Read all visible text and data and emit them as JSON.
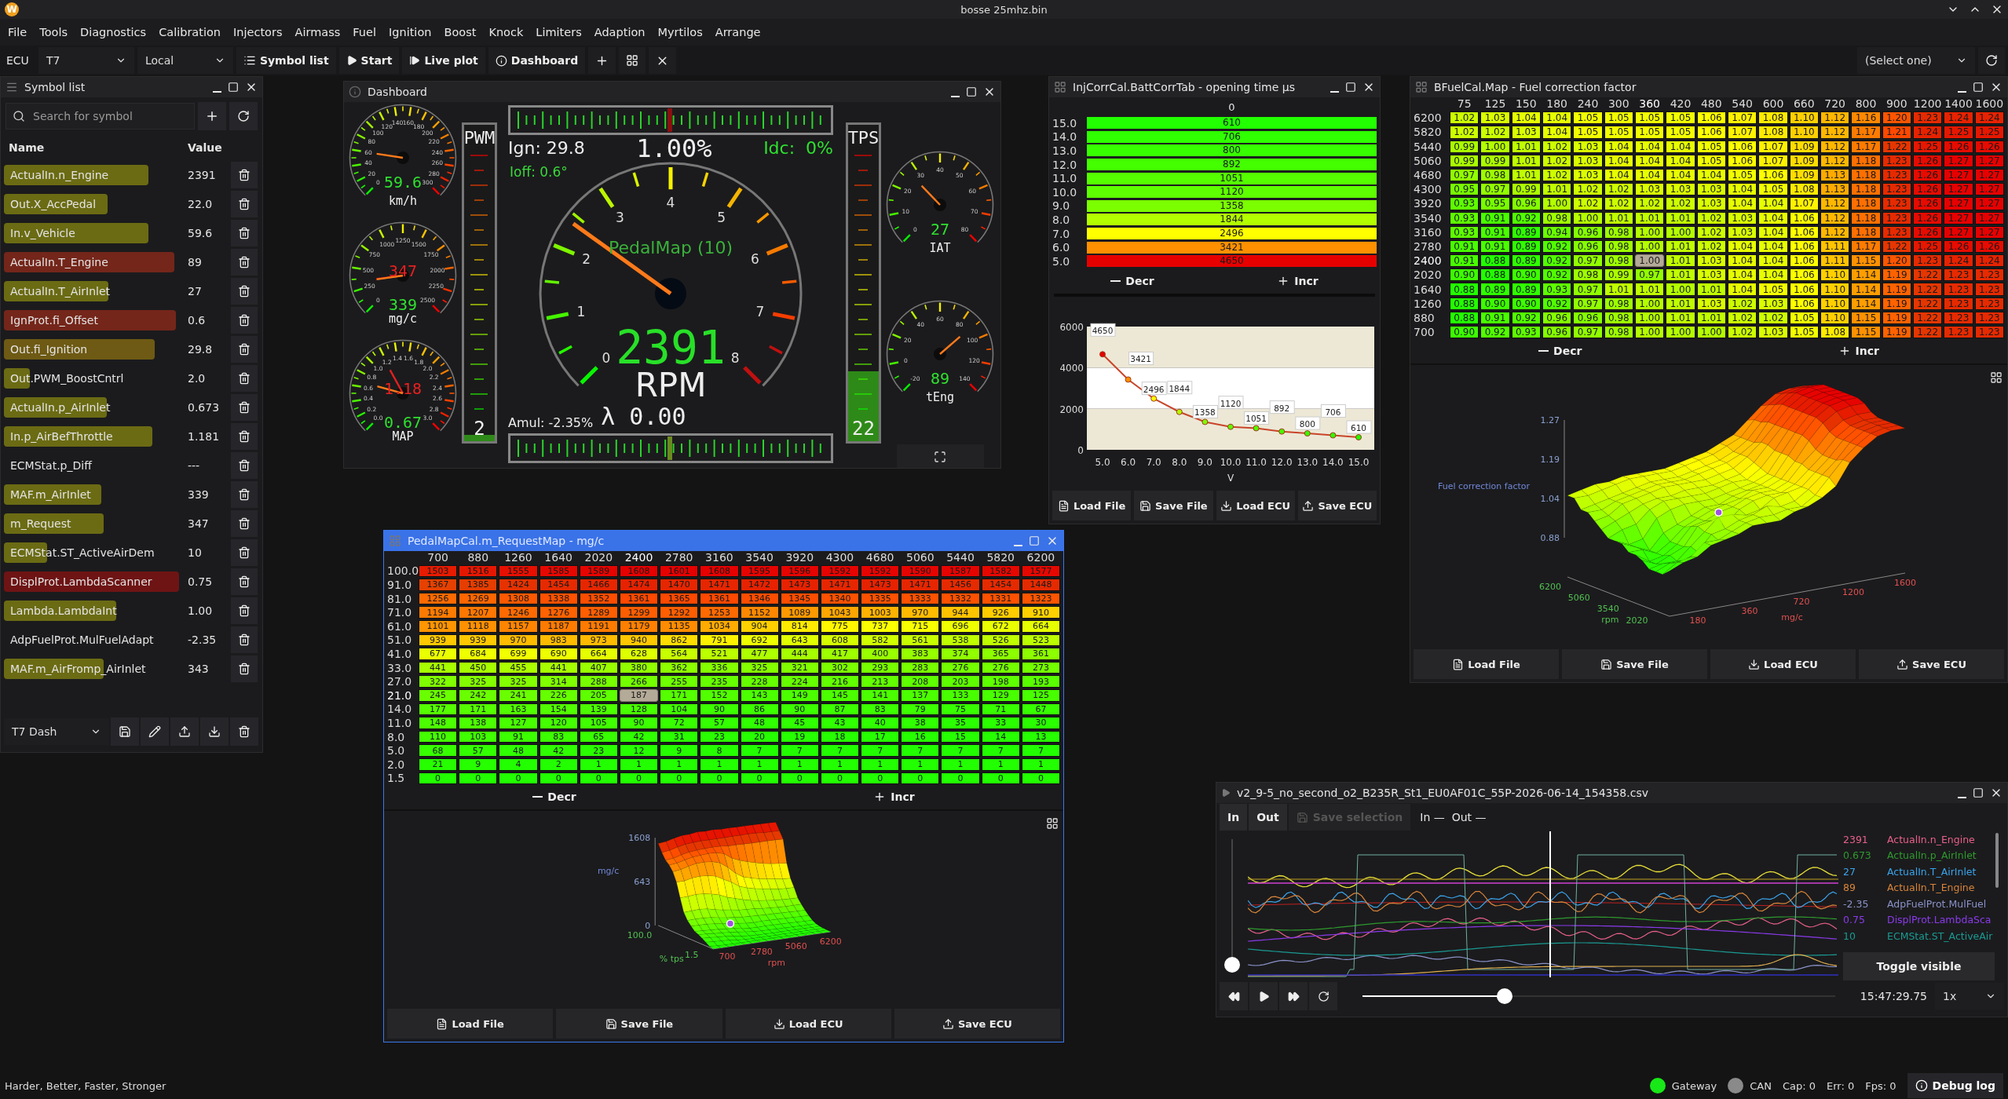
{
  "app": {
    "logo": "W",
    "title": "bosse 25mhz.bin"
  },
  "menu": [
    "File",
    "Tools",
    "Diagnostics",
    "Calibration",
    "Injectors",
    "Airmass",
    "Fuel",
    "Ignition",
    "Boost",
    "Knock",
    "Limiters",
    "Adaption",
    "Myrtilos",
    "Arrange"
  ],
  "toolbar": {
    "ecu_label": "ECU",
    "ecu": "T7",
    "source": "Local",
    "buttons": [
      {
        "label": "Symbol list",
        "kind": "list"
      },
      {
        "label": "Start",
        "kind": "play"
      },
      {
        "label": "Live plot",
        "kind": "step"
      },
      {
        "label": "Dashboard",
        "kind": "info"
      }
    ],
    "icon_buttons": [
      {
        "kind": "plus"
      },
      {
        "kind": "grid"
      },
      {
        "kind": "close"
      }
    ],
    "profile_select": "(Select one)"
  },
  "symbol_list": {
    "title": "Symbol list",
    "kind": "menu",
    "active": false,
    "search_placeholder": "Search for symbol",
    "columns": [
      "Name",
      "Value"
    ],
    "rows": [
      {
        "name": "ActualIn.n_Engine",
        "value": "2391",
        "color": "#6b6b14"
      },
      {
        "name": "Out.X_AccPedal",
        "value": "22.0",
        "color": "#6b6b14"
      },
      {
        "name": "In.v_Vehicle",
        "value": "59.6",
        "color": "#6b6b14"
      },
      {
        "name": "ActualIn.T_Engine",
        "value": "89",
        "color": "#74261a"
      },
      {
        "name": "ActualIn.T_AirInlet",
        "value": "27",
        "color": "#6b6b14"
      },
      {
        "name": "IgnProt.fi_Offset",
        "value": "0.6",
        "color": "#74261a"
      },
      {
        "name": "Out.fi_Ignition",
        "value": "29.8",
        "color": "#6e5a14"
      },
      {
        "name": "Out.PWM_BoostCntrl",
        "value": "2.0",
        "color": "#6b6b14"
      },
      {
        "name": "ActualIn.p_AirInlet",
        "value": "0.673",
        "color": "#6b6b14"
      },
      {
        "name": "In.p_AirBefThrottle",
        "value": "1.181",
        "color": "#6b6b14"
      },
      {
        "name": "ECMStat.p_Diff",
        "value": "---"
      },
      {
        "name": "MAF.m_AirInlet",
        "value": "339",
        "color": "#6b6b14"
      },
      {
        "name": "m_Request",
        "value": "347",
        "color": "#6b6b14"
      },
      {
        "name": "ECMStat.ST_ActiveAirDem",
        "value": "10",
        "color": "#6b6b14"
      },
      {
        "name": "DisplProt.LambdaScanner",
        "value": "0.75",
        "color": "#6e1414"
      },
      {
        "name": "Lambda.LambdaInt",
        "value": "1.00",
        "color": "#6b6b14"
      },
      {
        "name": "AdpFuelProt.MulFuelAdapt",
        "value": "-2.35"
      },
      {
        "name": "MAF.m_AirFromp_AirInlet",
        "value": "343",
        "color": "#6b6b14"
      }
    ],
    "profile": "T7 Dash"
  },
  "dashboard": {
    "title": "Dashboard",
    "kind": "info",
    "active": false,
    "left_gauges": [
      {
        "labels": [
          "0",
          "20",
          "40",
          "60",
          "80",
          "100",
          "120",
          "140",
          "160",
          "180",
          "200",
          "220",
          "240",
          "260",
          "280",
          "300"
        ],
        "readings": [
          {
            "text": "59.6",
            "kind": "actual"
          }
        ],
        "unit": "km/h"
      },
      {
        "labels": [
          "0",
          "250",
          "500",
          "750",
          "1000",
          "1250",
          "1500",
          "1750",
          "2000",
          "2250",
          "2500"
        ],
        "readings": [
          {
            "text": "347",
            "kind": "target"
          },
          {
            "text": "339",
            "kind": "actual"
          }
        ],
        "unit": "mg/c"
      },
      {
        "labels": [
          "0.0",
          "0.2",
          "0.4",
          "0.6",
          "0.8",
          "1.0",
          "1.2",
          "1.4",
          "1.6",
          "1.8",
          "2.0",
          "2.2",
          "2.4",
          "2.6",
          "2.8",
          "3.0"
        ],
        "readings": [
          {
            "text": "1.18",
            "kind": "target"
          },
          {
            "text": "0.67",
            "kind": "actual"
          }
        ],
        "unit": "MAP"
      }
    ],
    "pwm": {
      "label": "PWM",
      "value": "2",
      "level": 0.02
    },
    "tps": {
      "label": "TPS",
      "value": "22",
      "level": 0.22
    },
    "ign": "Ign: 29.8",
    "load": "1.00%",
    "idc": "Idc:  0%",
    "ioff": "Ioff: 0.6°",
    "rpm": {
      "labels": [
        "0",
        "1",
        "2",
        "3",
        "4",
        "5",
        "6",
        "7",
        "8"
      ],
      "reading": "2391",
      "unit": "RPM",
      "caption": "PedalMap (10)"
    },
    "amul": "Amul: -2.35%",
    "lambda": "λ 0.00",
    "right_gauges": [
      {
        "labels": [
          "0",
          "10",
          "20",
          "30",
          "40",
          "50",
          "60",
          "70",
          "80"
        ],
        "readings": [
          {
            "text": "27",
            "kind": "actual"
          }
        ],
        "unit": "IAT"
      },
      {
        "labels": [
          "-20",
          "0",
          "20",
          "40",
          "60",
          "80",
          "100",
          "120",
          "140"
        ],
        "readings": [
          {
            "text": "89",
            "kind": "actual"
          }
        ],
        "unit": "tEng"
      }
    ]
  },
  "inj_corr": {
    "title": "InjCorrCal.BattCorrTab - opening time μs",
    "kind": "grid",
    "active": false,
    "column": "0",
    "rows": [
      {
        "label": "15.0",
        "value": "610"
      },
      {
        "label": "14.0",
        "value": "706"
      },
      {
        "label": "13.0",
        "value": "800"
      },
      {
        "label": "12.0",
        "value": "892"
      },
      {
        "label": "11.0",
        "value": "1051"
      },
      {
        "label": "10.0",
        "value": "1120"
      },
      {
        "label": "9.0",
        "value": "1358"
      },
      {
        "label": "8.0",
        "value": "1844"
      },
      {
        "label": "7.0",
        "value": "2496"
      },
      {
        "label": "6.0",
        "value": "3421"
      },
      {
        "label": "5.0",
        "value": "4650"
      }
    ],
    "decr": "Decr",
    "incr": "Incr",
    "chart_data": {
      "type": "line",
      "xlabel": "V",
      "categories": [
        "5.0",
        "6.0",
        "7.0",
        "8.0",
        "9.0",
        "10.0",
        "11.0",
        "12.0",
        "13.0",
        "14.0",
        "15.0"
      ],
      "series": [
        {
          "color": "#c8452a",
          "marker": "circle",
          "values": [
            4650,
            3421,
            2496,
            1844,
            1358,
            1120,
            1051,
            892,
            800,
            706,
            610
          ]
        }
      ],
      "ylim": [
        0,
        6000
      ],
      "yticks": [
        0,
        2000,
        4000,
        6000
      ],
      "data_labels": true
    },
    "buttons": [
      {
        "label": "Load File",
        "kind": "file"
      },
      {
        "label": "Save File",
        "kind": "save"
      },
      {
        "label": "Load ECU",
        "kind": "download"
      },
      {
        "label": "Save ECU",
        "kind": "upload"
      }
    ]
  },
  "bfuel": {
    "title": "BFuelCal.Map - Fuel correction factor",
    "kind": "grid",
    "active": false,
    "columns": [
      {
        "label": "75",
        "selected": false
      },
      {
        "label": "125",
        "selected": false
      },
      {
        "label": "150",
        "selected": false
      },
      {
        "label": "180",
        "selected": false
      },
      {
        "label": "240",
        "selected": false
      },
      {
        "label": "300",
        "selected": false
      },
      {
        "label": "360",
        "selected": true
      },
      {
        "label": "420",
        "selected": false
      },
      {
        "label": "480",
        "selected": false
      },
      {
        "label": "540",
        "selected": false
      },
      {
        "label": "600",
        "selected": false
      },
      {
        "label": "660",
        "selected": false
      },
      {
        "label": "720",
        "selected": false
      },
      {
        "label": "800",
        "selected": false
      },
      {
        "label": "900",
        "selected": false
      },
      {
        "label": "1200",
        "selected": false
      },
      {
        "label": "1400",
        "selected": false
      },
      {
        "label": "1600",
        "selected": false
      }
    ],
    "rows": [
      {
        "label": "6200",
        "selected": false,
        "values": [
          "1.02",
          "1.03",
          "1.04",
          "1.04",
          "1.05",
          "1.05",
          "1.05",
          "1.05",
          "1.06",
          "1.07",
          "1.08",
          "1.10",
          "1.12",
          "1.16",
          "1.20",
          "1.23",
          "1.24",
          "1.24"
        ]
      },
      {
        "label": "5820",
        "selected": false,
        "values": [
          "1.02",
          "1.02",
          "1.03",
          "1.04",
          "1.05",
          "1.05",
          "1.05",
          "1.05",
          "1.06",
          "1.07",
          "1.08",
          "1.10",
          "1.12",
          "1.17",
          "1.21",
          "1.24",
          "1.25",
          "1.25"
        ]
      },
      {
        "label": "5440",
        "selected": false,
        "values": [
          "0.99",
          "1.00",
          "1.01",
          "1.02",
          "1.03",
          "1.04",
          "1.04",
          "1.04",
          "1.05",
          "1.06",
          "1.07",
          "1.09",
          "1.12",
          "1.17",
          "1.22",
          "1.25",
          "1.26",
          "1.26"
        ]
      },
      {
        "label": "5060",
        "selected": false,
        "values": [
          "0.99",
          "0.99",
          "1.01",
          "1.02",
          "1.03",
          "1.04",
          "1.04",
          "1.04",
          "1.05",
          "1.06",
          "1.07",
          "1.09",
          "1.12",
          "1.18",
          "1.23",
          "1.26",
          "1.27",
          "1.27"
        ]
      },
      {
        "label": "4680",
        "selected": false,
        "values": [
          "0.97",
          "0.98",
          "1.01",
          "1.02",
          "1.03",
          "1.04",
          "1.04",
          "1.04",
          "1.04",
          "1.05",
          "1.06",
          "1.09",
          "1.13",
          "1.18",
          "1.23",
          "1.26",
          "1.27",
          "1.27"
        ]
      },
      {
        "label": "4300",
        "selected": false,
        "values": [
          "0.95",
          "0.97",
          "0.99",
          "1.01",
          "1.02",
          "1.02",
          "1.03",
          "1.03",
          "1.03",
          "1.04",
          "1.05",
          "1.08",
          "1.13",
          "1.18",
          "1.23",
          "1.26",
          "1.27",
          "1.27"
        ]
      },
      {
        "label": "3920",
        "selected": false,
        "values": [
          "0.93",
          "0.95",
          "0.96",
          "1.00",
          "1.02",
          "1.02",
          "1.02",
          "1.02",
          "1.03",
          "1.04",
          "1.04",
          "1.07",
          "1.12",
          "1.18",
          "1.23",
          "1.26",
          "1.27",
          "1.27"
        ]
      },
      {
        "label": "3540",
        "selected": false,
        "values": [
          "0.93",
          "0.91",
          "0.92",
          "0.98",
          "1.00",
          "1.01",
          "1.01",
          "1.01",
          "1.02",
          "1.03",
          "1.04",
          "1.06",
          "1.12",
          "1.18",
          "1.23",
          "1.26",
          "1.27",
          "1.27"
        ]
      },
      {
        "label": "3160",
        "selected": false,
        "values": [
          "0.93",
          "0.91",
          "0.89",
          "0.94",
          "0.96",
          "0.98",
          "1.00",
          "1.00",
          "1.02",
          "1.03",
          "1.04",
          "1.06",
          "1.12",
          "1.18",
          "1.23",
          "1.26",
          "1.27",
          "1.27"
        ]
      },
      {
        "label": "2780",
        "selected": false,
        "values": [
          "0.91",
          "0.91",
          "0.89",
          "0.92",
          "0.96",
          "0.98",
          "1.00",
          "1.01",
          "1.02",
          "1.04",
          "1.04",
          "1.06",
          "1.11",
          "1.17",
          "1.22",
          "1.25",
          "1.26",
          "1.26"
        ]
      },
      {
        "label": "2400",
        "selected": true,
        "values": [
          "0.91",
          "0.88",
          "0.89",
          "0.92",
          "0.97",
          "0.98",
          "1.00",
          "1.01",
          "1.03",
          "1.04",
          "1.04",
          "1.06",
          "1.11",
          "1.15",
          "1.20",
          "1.23",
          "1.24",
          "1.24"
        ]
      },
      {
        "label": "2020",
        "selected": false,
        "values": [
          "0.90",
          "0.88",
          "0.90",
          "0.92",
          "0.98",
          "0.99",
          "0.97",
          "1.01",
          "1.03",
          "1.04",
          "1.04",
          "1.06",
          "1.10",
          "1.14",
          "1.19",
          "1.22",
          "1.23",
          "1.23"
        ]
      },
      {
        "label": "1640",
        "selected": false,
        "values": [
          "0.88",
          "0.89",
          "0.89",
          "0.93",
          "0.97",
          "1.01",
          "1.01",
          "1.00",
          "1.01",
          "1.04",
          "1.05",
          "1.06",
          "1.10",
          "1.14",
          "1.19",
          "1.22",
          "1.23",
          "1.23"
        ]
      },
      {
        "label": "1260",
        "selected": false,
        "values": [
          "0.88",
          "0.90",
          "0.90",
          "0.92",
          "0.97",
          "0.98",
          "1.00",
          "1.01",
          "1.03",
          "1.02",
          "1.03",
          "1.06",
          "1.10",
          "1.14",
          "1.19",
          "1.22",
          "1.23",
          "1.23"
        ]
      },
      {
        "label": "880",
        "selected": false,
        "values": [
          "0.88",
          "0.91",
          "0.92",
          "0.96",
          "0.96",
          "0.98",
          "1.00",
          "1.01",
          "1.01",
          "1.02",
          "1.02",
          "1.05",
          "1.10",
          "1.15",
          "1.19",
          "1.22",
          "1.23",
          "1.23"
        ]
      },
      {
        "label": "700",
        "selected": false,
        "values": [
          "0.90",
          "0.92",
          "0.93",
          "0.96",
          "0.97",
          "0.98",
          "1.00",
          "1.00",
          "1.00",
          "1.02",
          "1.03",
          "1.05",
          "1.08",
          "1.15",
          "1.19",
          "1.22",
          "1.23",
          "1.23"
        ]
      }
    ],
    "decr": "Decr",
    "incr": "Incr",
    "surface": {
      "z_title": "Fuel correction factor",
      "z_ticks": [
        "1.27",
        "1.19",
        "1.04",
        "0.88"
      ],
      "y_title": "rpm",
      "y_ticks": [
        "6200",
        "5060",
        "3540",
        "2020"
      ],
      "x_title": "mg/c",
      "x_ticks": [
        "180",
        "360",
        "720",
        "1200",
        "1600"
      ]
    },
    "buttons": [
      {
        "label": "Load File",
        "kind": "file"
      },
      {
        "label": "Save File",
        "kind": "save"
      },
      {
        "label": "Load ECU",
        "kind": "download"
      },
      {
        "label": "Save ECU",
        "kind": "upload"
      }
    ]
  },
  "pedal": {
    "title": "PedalMapCal.m_RequestMap - mg/c",
    "kind": "grid",
    "active": true,
    "columns": [
      {
        "label": "700",
        "selected": false
      },
      {
        "label": "880",
        "selected": false
      },
      {
        "label": "1260",
        "selected": false
      },
      {
        "label": "1640",
        "selected": false
      },
      {
        "label": "2020",
        "selected": false
      },
      {
        "label": "2400",
        "selected": true
      },
      {
        "label": "2780",
        "selected": false
      },
      {
        "label": "3160",
        "selected": false
      },
      {
        "label": "3540",
        "selected": false
      },
      {
        "label": "3920",
        "selected": false
      },
      {
        "label": "4300",
        "selected": false
      },
      {
        "label": "4680",
        "selected": false
      },
      {
        "label": "5060",
        "selected": false
      },
      {
        "label": "5440",
        "selected": false
      },
      {
        "label": "5820",
        "selected": false
      },
      {
        "label": "6200",
        "selected": false
      }
    ],
    "rows": [
      {
        "label": "100.0",
        "selected": false,
        "values": [
          "1503",
          "1516",
          "1555",
          "1585",
          "1589",
          "1608",
          "1601",
          "1608",
          "1595",
          "1596",
          "1592",
          "1592",
          "1590",
          "1587",
          "1582",
          "1577"
        ]
      },
      {
        "label": "91.0",
        "selected": false,
        "values": [
          "1367",
          "1385",
          "1424",
          "1454",
          "1466",
          "1474",
          "1470",
          "1471",
          "1472",
          "1473",
          "1471",
          "1473",
          "1471",
          "1456",
          "1454",
          "1448"
        ]
      },
      {
        "label": "81.0",
        "selected": false,
        "values": [
          "1256",
          "1269",
          "1308",
          "1338",
          "1352",
          "1361",
          "1365",
          "1361",
          "1346",
          "1345",
          "1340",
          "1335",
          "1333",
          "1332",
          "1331",
          "1323"
        ]
      },
      {
        "label": "71.0",
        "selected": false,
        "values": [
          "1194",
          "1207",
          "1246",
          "1276",
          "1289",
          "1299",
          "1292",
          "1253",
          "1152",
          "1089",
          "1043",
          "1003",
          "970",
          "944",
          "926",
          "910"
        ]
      },
      {
        "label": "61.0",
        "selected": false,
        "values": [
          "1101",
          "1118",
          "1157",
          "1187",
          "1191",
          "1179",
          "1135",
          "1034",
          "904",
          "814",
          "775",
          "737",
          "715",
          "696",
          "672",
          "664"
        ]
      },
      {
        "label": "51.0",
        "selected": false,
        "values": [
          "939",
          "939",
          "970",
          "983",
          "973",
          "940",
          "862",
          "791",
          "692",
          "643",
          "608",
          "582",
          "561",
          "538",
          "526",
          "523"
        ]
      },
      {
        "label": "41.0",
        "selected": false,
        "values": [
          "677",
          "684",
          "699",
          "690",
          "664",
          "628",
          "564",
          "521",
          "477",
          "444",
          "417",
          "400",
          "383",
          "374",
          "365",
          "361"
        ]
      },
      {
        "label": "33.0",
        "selected": false,
        "values": [
          "441",
          "450",
          "455",
          "441",
          "407",
          "380",
          "362",
          "336",
          "325",
          "321",
          "302",
          "293",
          "283",
          "276",
          "276",
          "273"
        ]
      },
      {
        "label": "27.0",
        "selected": false,
        "values": [
          "322",
          "325",
          "325",
          "314",
          "288",
          "266",
          "255",
          "235",
          "228",
          "224",
          "216",
          "213",
          "208",
          "203",
          "198",
          "193"
        ]
      },
      {
        "label": "21.0",
        "selected": true,
        "values": [
          "245",
          "242",
          "241",
          "226",
          "205",
          "187",
          "171",
          "152",
          "143",
          "149",
          "145",
          "141",
          "137",
          "133",
          "129",
          "125"
        ]
      },
      {
        "label": "14.0",
        "selected": false,
        "values": [
          "177",
          "171",
          "163",
          "154",
          "139",
          "128",
          "104",
          "90",
          "86",
          "90",
          "87",
          "83",
          "79",
          "75",
          "71",
          "67"
        ]
      },
      {
        "label": "11.0",
        "selected": false,
        "values": [
          "148",
          "138",
          "127",
          "120",
          "105",
          "90",
          "72",
          "57",
          "48",
          "45",
          "43",
          "40",
          "38",
          "35",
          "33",
          "30"
        ]
      },
      {
        "label": "8.0",
        "selected": false,
        "values": [
          "110",
          "103",
          "91",
          "83",
          "65",
          "42",
          "31",
          "23",
          "20",
          "19",
          "18",
          "17",
          "16",
          "15",
          "14",
          "13"
        ]
      },
      {
        "label": "5.0",
        "selected": false,
        "values": [
          "68",
          "57",
          "48",
          "42",
          "23",
          "12",
          "9",
          "8",
          "7",
          "7",
          "7",
          "7",
          "7",
          "7",
          "7",
          "7"
        ]
      },
      {
        "label": "2.0",
        "selected": false,
        "values": [
          "21",
          "9",
          "4",
          "2",
          "1",
          "1",
          "1",
          "1",
          "1",
          "1",
          "1",
          "1",
          "1",
          "1",
          "1",
          "1"
        ]
      },
      {
        "label": "1.5",
        "selected": false,
        "values": [
          "0",
          "0",
          "0",
          "0",
          "0",
          "0",
          "0",
          "0",
          "0",
          "0",
          "0",
          "0",
          "0",
          "0",
          "0",
          "0"
        ]
      }
    ],
    "decr": "Decr",
    "incr": "Incr",
    "surface": {
      "z_title": "mg/c",
      "z_ticks": [
        "1608",
        "643",
        "0"
      ],
      "y_title": "% tps",
      "y_ticks": [
        "100.0",
        "1.5"
      ],
      "x_title": "rpm",
      "x_ticks": [
        "700",
        "2780",
        "5060",
        "6200"
      ]
    },
    "buttons": [
      {
        "label": "Load File",
        "kind": "file"
      },
      {
        "label": "Save File",
        "kind": "save"
      },
      {
        "label": "Load ECU",
        "kind": "download"
      },
      {
        "label": "Save ECU",
        "kind": "upload"
      }
    ]
  },
  "log": {
    "title": "v2_9-5_no_second_o2_B235R_St1_EU0AF01C_55P-2026-06-14_154358.csv",
    "kind": "play",
    "active": false,
    "buttons": [
      {
        "label": "In",
        "kind": "plain",
        "disabled": false
      },
      {
        "label": "Out",
        "kind": "plain",
        "disabled": false
      },
      {
        "label": "Save selection",
        "kind": "save",
        "disabled": true
      }
    ],
    "markers": "In —  Out —",
    "zoom": {
      "level": 0
    },
    "legend": [
      {
        "value": "2391",
        "name": "ActualIn.n_Engine",
        "color": "#e8608a"
      },
      {
        "value": "0.673",
        "name": "ActualIn.p_AirInlet",
        "color": "#2e9a2e"
      },
      {
        "value": "27",
        "name": "ActualIn.T_AirInlet",
        "color": "#3aa4ec"
      },
      {
        "value": "89",
        "name": "ActualIn.T_Engine",
        "color": "#d8843a"
      },
      {
        "value": "-2.35",
        "name": "AdpFuelProt.MulFuel",
        "color": "#8a92c8"
      },
      {
        "value": "0.75",
        "name": "DisplProt.LambdaSca",
        "color": "#8a3aea"
      },
      {
        "value": "10",
        "name": "ECMStat.ST_ActiveAir",
        "color": "#1a9a92"
      }
    ],
    "toggle": "Toggle visible",
    "position": {
      "level": 0.3
    },
    "time": "15:47:29.75",
    "speed": "1x"
  },
  "status_bar": {
    "text": "Harder, Better, Faster, Stronger",
    "links": [
      {
        "label": "Gateway",
        "on": true
      },
      {
        "label": "CAN",
        "on": false
      }
    ],
    "counters": [
      "Cap: 0",
      "Err: 0",
      "Fps: 0"
    ],
    "debug": "Debug log"
  }
}
